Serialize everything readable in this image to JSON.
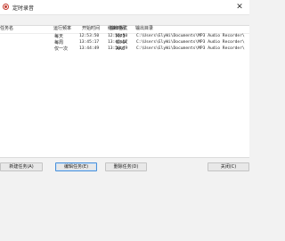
{
  "window": {
    "title": "定时录音",
    "close_symbol": "✕"
  },
  "table": {
    "columns": [
      "任务名",
      "运行频率",
      "开始时间",
      "结束时间",
      "输出格式",
      "输出目录"
    ],
    "rows": [
      [
        "",
        "每天",
        "12:53:50",
        "12:55:50",
        "MP3",
        "C:\\Users\\ElyWi\\Documents\\MP3 Audio Recorder\\"
      ],
      [
        "",
        "每周",
        "13:45:17",
        "13:45:17",
        "WMA",
        "C:\\Users\\ElyWi\\Documents\\MP3 Audio Recorder\\"
      ],
      [
        "",
        "仅一次",
        "13:44:49",
        "13:58:49",
        "AAC",
        "C:\\Users\\ElyWi\\Documents\\MP3 Audio Recorder\\"
      ]
    ]
  },
  "buttons": {
    "add": "新建任务(A)",
    "edit": "编辑任务(E)",
    "delete": "删除任务(D)",
    "close": "关闭(C)"
  }
}
